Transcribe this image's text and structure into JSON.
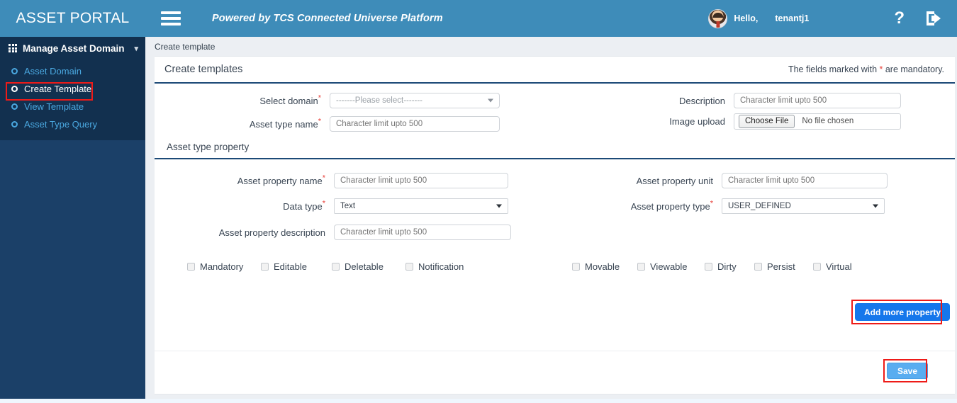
{
  "header": {
    "brand": "ASSET PORTAL",
    "menu_icon": "hamburger-icon",
    "powered_by": "Powered by TCS Connected Universe Platform",
    "greeting": "Hello,",
    "username": "tenantj1",
    "help_icon": "?",
    "logout_icon": "logout-icon"
  },
  "sidebar": {
    "group_label": "Manage Asset Domain",
    "items": [
      {
        "label": "Asset Domain",
        "active": false
      },
      {
        "label": "Create Template",
        "active": true
      },
      {
        "label": "View Template",
        "active": false
      },
      {
        "label": "Asset Type Query",
        "active": false
      }
    ]
  },
  "breadcrumb": "Create template",
  "card": {
    "title": "Create templates",
    "mandatory_note_prefix": "The fields marked with ",
    "mandatory_star": "*",
    "mandatory_note_suffix": " are mandatory."
  },
  "form": {
    "select_domain": {
      "label": "Select domain",
      "required": true,
      "value": "-------Please select-------"
    },
    "asset_type_name": {
      "label": "Asset type name",
      "required": true,
      "value": "",
      "placeholder": "Character limit upto 500"
    },
    "description": {
      "label": "Description",
      "required": false,
      "value": "",
      "placeholder": "Character limit upto 500"
    },
    "image_upload": {
      "label": "Image upload",
      "button": "Choose File",
      "status": "No file chosen"
    }
  },
  "property_section": {
    "heading": "Asset type property",
    "asset_property_name": {
      "label": "Asset property name",
      "required": true,
      "value": "",
      "placeholder": "Character limit upto 500"
    },
    "data_type": {
      "label": "Data type",
      "required": true,
      "value": "Text"
    },
    "asset_property_description": {
      "label": "Asset property description",
      "required": false,
      "value": "",
      "placeholder": "Character limit upto 500"
    },
    "asset_property_unit": {
      "label": "Asset property unit",
      "required": false,
      "value": "",
      "placeholder": "Character limit upto 500"
    },
    "asset_property_type": {
      "label": "Asset property type",
      "required": true,
      "value": "USER_DEFINED"
    },
    "checkboxes_left": [
      {
        "label": "Mandatory",
        "checked": false
      },
      {
        "label": "Editable",
        "checked": false
      },
      {
        "label": "Deletable",
        "checked": false
      },
      {
        "label": "Notification",
        "checked": false
      }
    ],
    "checkboxes_right": [
      {
        "label": "Movable",
        "checked": false
      },
      {
        "label": "Viewable",
        "checked": false
      },
      {
        "label": "Dirty",
        "checked": false
      },
      {
        "label": "Persist",
        "checked": false
      },
      {
        "label": "Virtual",
        "checked": false
      }
    ]
  },
  "actions": {
    "add_more_property": "Add more property",
    "save": "Save"
  },
  "colors": {
    "header_blue": "#3e8cb9",
    "sidebar_navy": "#1b4068",
    "sidebar_submenu_navy": "#12304f",
    "link_blue": "#4aa8e0",
    "primary_button": "#1577eb",
    "save_button": "#59adf0",
    "highlight_red": "#ee1b18",
    "required_star": "#e8413a",
    "rule_navy": "#1c4a77",
    "page_bg": "#eceff3",
    "footer_strip": "#eff6fd"
  }
}
